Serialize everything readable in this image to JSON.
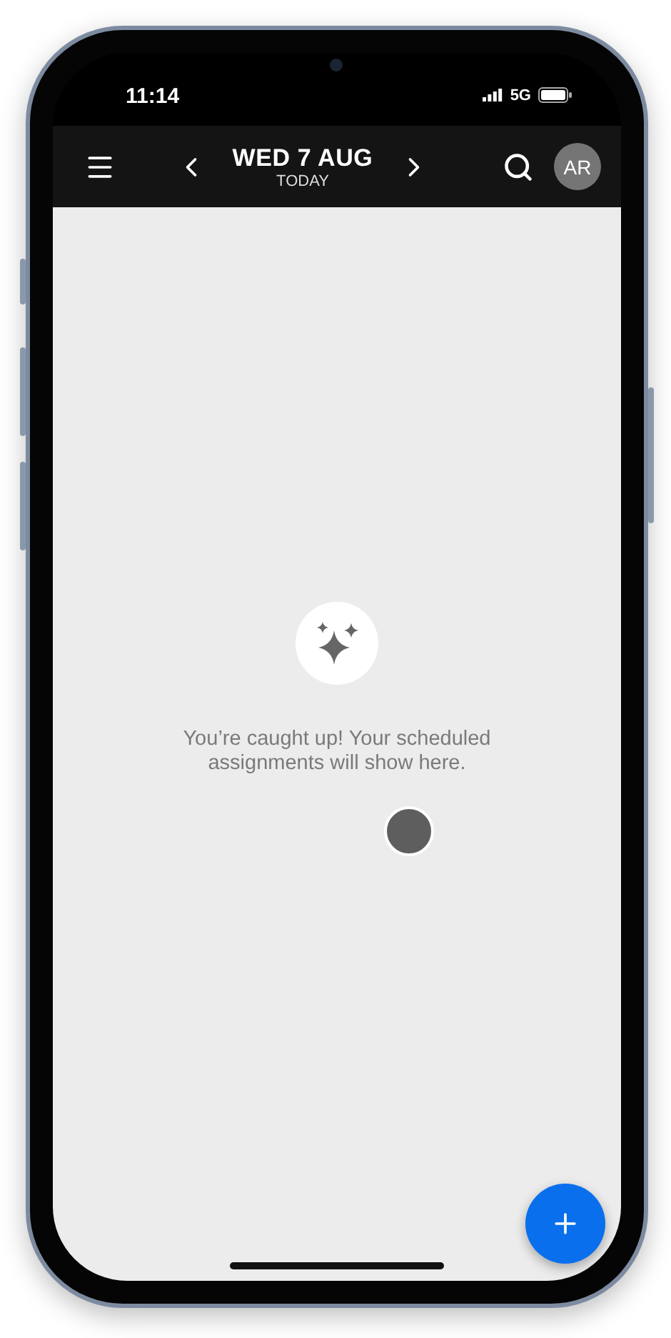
{
  "status_bar": {
    "time": "11:14",
    "network": "5G"
  },
  "app_bar": {
    "date": "WED 7 AUG",
    "subtitle": "TODAY",
    "avatar": "AR"
  },
  "empty_state": {
    "message": "You’re caught up! Your scheduled assignments will show here."
  }
}
